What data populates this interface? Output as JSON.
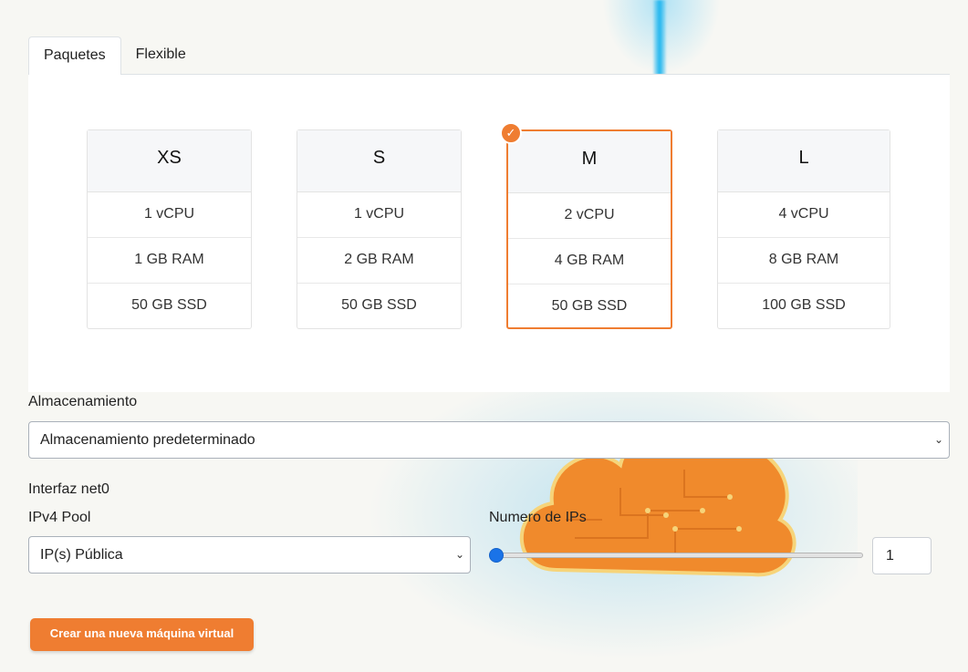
{
  "tabs": [
    {
      "label": "Paquetes",
      "active": true
    },
    {
      "label": "Flexible",
      "active": false
    }
  ],
  "plans": [
    {
      "name": "XS",
      "cpu": "1 vCPU",
      "ram": "1 GB RAM",
      "disk": "50 GB SSD",
      "selected": false
    },
    {
      "name": "S",
      "cpu": "1 vCPU",
      "ram": "2 GB RAM",
      "disk": "50 GB SSD",
      "selected": false
    },
    {
      "name": "M",
      "cpu": "2 vCPU",
      "ram": "4 GB RAM",
      "disk": "50 GB SSD",
      "selected": true
    },
    {
      "name": "L",
      "cpu": "4 vCPU",
      "ram": "8 GB RAM",
      "disk": "100 GB SSD",
      "selected": false
    }
  ],
  "storage": {
    "label": "Almacenamiento",
    "selected": "Almacenamiento predeterminado"
  },
  "network": {
    "interface_label": "Interfaz net0",
    "pool_label": "IPv4 Pool",
    "pool_selected": "IP(s) Pública",
    "ips_label": "Numero de IPs",
    "ips_value": "1",
    "ips_slider_fraction": 0.0
  },
  "actions": {
    "create_label": "Crear una nueva máquina virtual"
  },
  "colors": {
    "accent": "#ef7d31",
    "slider": "#1a73e8"
  }
}
